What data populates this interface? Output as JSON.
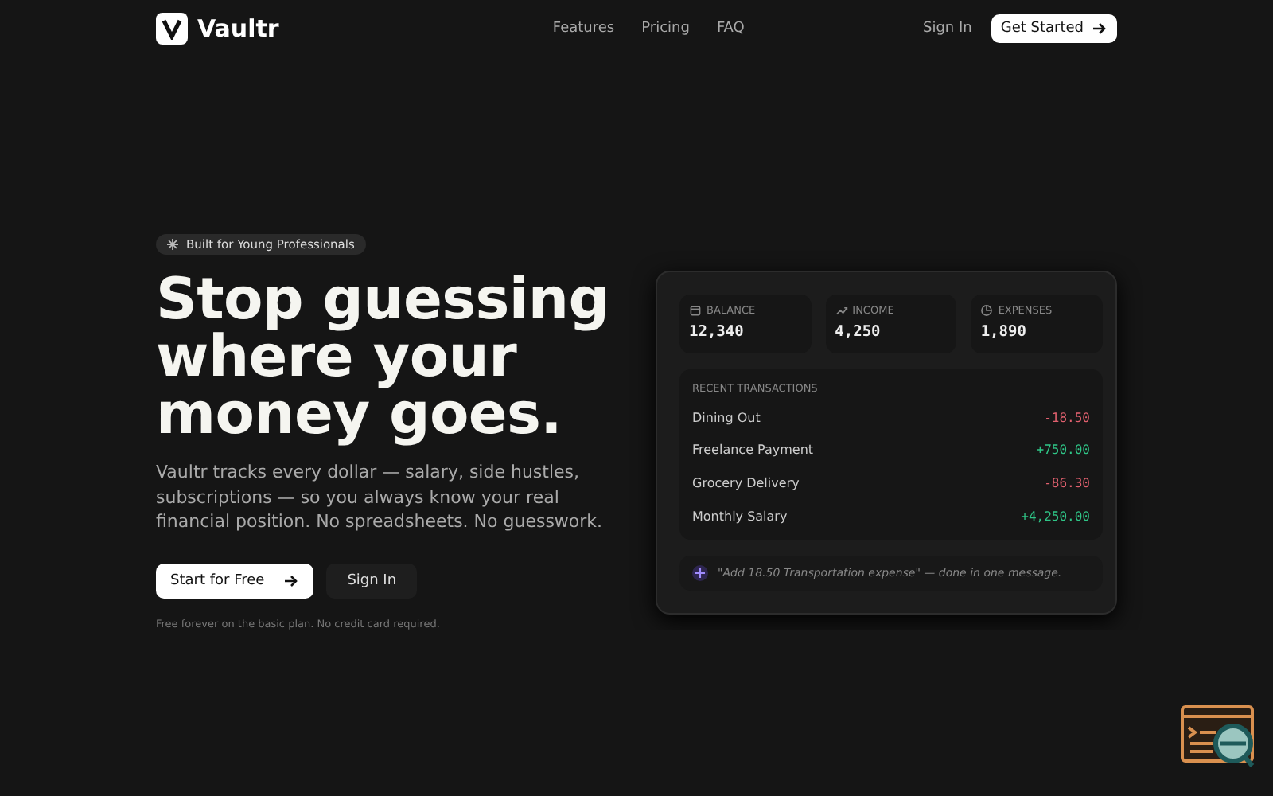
{
  "nav": {
    "brand": "Vaultr",
    "links": [
      "Features",
      "Pricing",
      "FAQ"
    ],
    "sign_in": "Sign In",
    "cta": "Get Started"
  },
  "hero": {
    "badge": "Built for Young Professionals",
    "headline": "Stop guessing where your money goes.",
    "description": "Vaultr tracks every dollar — salary, side hustles, subscriptions — so you always know your real financial position. No spreadsheets. No guesswork.",
    "primary_button": "Start for Free",
    "secondary_button": "Sign In",
    "note": "Free forever on the basic plan. No credit card required."
  },
  "dashboard": {
    "stats": [
      {
        "kind": "balance",
        "label": "BALANCE",
        "value": "12,340"
      },
      {
        "kind": "income",
        "label": "INCOME",
        "value": "4,250"
      },
      {
        "kind": "expenses",
        "label": "EXPENSES",
        "value": "1,890"
      }
    ],
    "transactions_title": "RECENT TRANSACTIONS",
    "transactions": [
      {
        "name": "Dining Out",
        "amount": "-18.50",
        "kind": "expense"
      },
      {
        "name": "Freelance Payment",
        "amount": "+750.00",
        "kind": "income"
      },
      {
        "name": "Grocery Delivery",
        "amount": "-86.30",
        "kind": "expense"
      },
      {
        "name": "Monthly Salary",
        "amount": "+4,250.00",
        "kind": "income"
      }
    ],
    "message": "\"Add 18.50 Transportation expense\" — done in one message."
  }
}
